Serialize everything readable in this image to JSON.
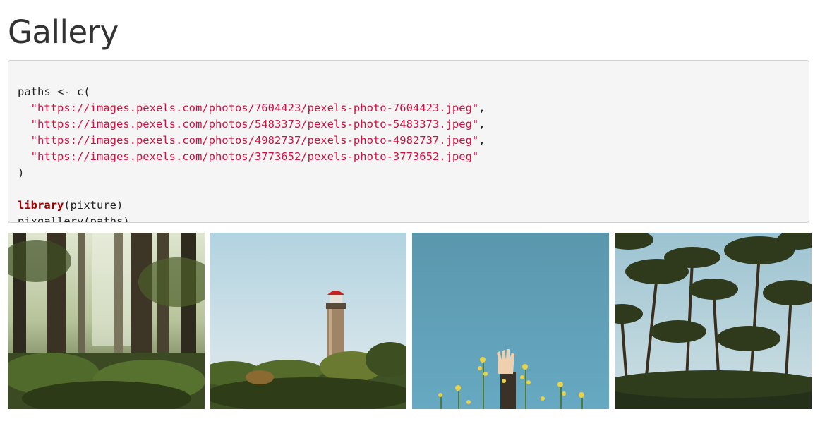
{
  "page": {
    "title": "Gallery"
  },
  "code": {
    "line1": "paths <- c(",
    "urls": [
      "\"https://images.pexels.com/photos/7604423/pexels-photo-7604423.jpeg\"",
      "\"https://images.pexels.com/photos/5483373/pexels-photo-5483373.jpeg\"",
      "\"https://images.pexels.com/photos/4982737/pexels-photo-4982737.jpeg\"",
      "\"https://images.pexels.com/photos/3773652/pexels-photo-3773652.jpeg\""
    ],
    "comma": ",",
    "close": ")",
    "lib_fn": "library",
    "lib_args": "(pixture)",
    "call": "pixgallery(paths)"
  },
  "gallery": {
    "images": [
      {
        "subject": "forest",
        "sky_color": "#c9d2b5",
        "main_color": "#3c4a2a"
      },
      {
        "subject": "lighthouse",
        "sky_color": "#b6d3e0",
        "main_color": "#4b5a2a"
      },
      {
        "subject": "raised-hand-with-flowers",
        "sky_color": "#5a9bb4",
        "main_color": "#e8d24a"
      },
      {
        "subject": "palm-trees",
        "sky_color": "#8fb8c8",
        "main_color": "#2f3a1c"
      }
    ]
  }
}
